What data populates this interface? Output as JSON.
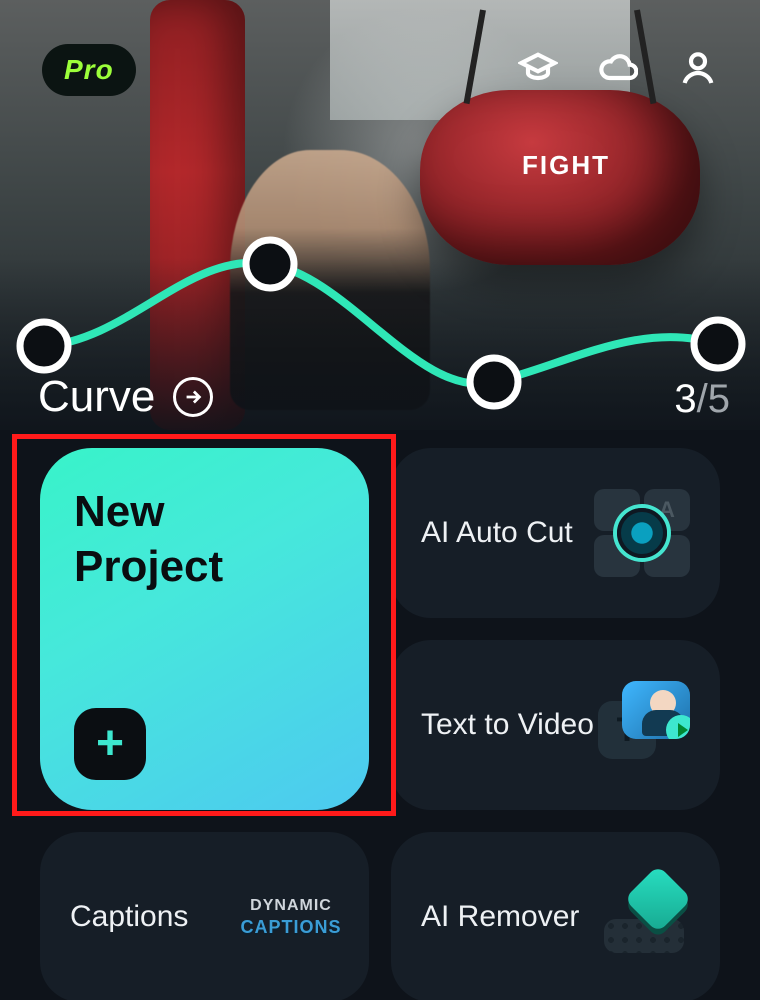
{
  "header": {
    "pro_label": "Pro",
    "icons": [
      "graduation-cap-icon",
      "cloud-icon",
      "profile-icon"
    ]
  },
  "hero": {
    "right_bag_text": "FIGHT",
    "overlay_label": "Curve",
    "counter_current": "3",
    "counter_sep": "/",
    "counter_total": "5"
  },
  "tiles": {
    "new_project": {
      "line1": "New",
      "line2": "Project"
    },
    "ai_auto_cut": {
      "label": "AI Auto Cut"
    },
    "text_to_video": {
      "label": "Text to Video"
    },
    "captions": {
      "label": "Captions",
      "thumb_line1": "DYNAMIC",
      "thumb_line2": "CAPTIONS"
    },
    "ai_remover": {
      "label": "AI Remover"
    }
  }
}
